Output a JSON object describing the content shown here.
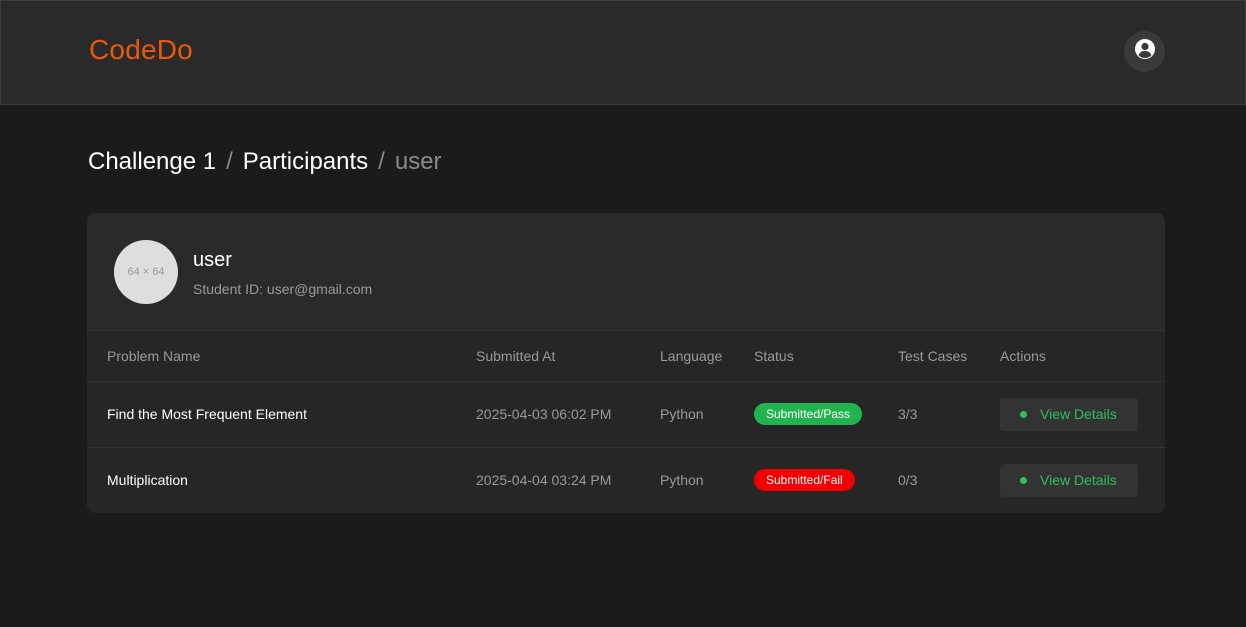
{
  "app": {
    "brand": "CodeDo"
  },
  "header": {
    "account_icon": "user-circle-icon"
  },
  "breadcrumb": {
    "items": [
      "Challenge 1",
      "Participants",
      "user"
    ],
    "separator": "/"
  },
  "profile": {
    "avatar_placeholder": "64 × 64",
    "name": "user",
    "student_id": "Student ID: user@gmail.com"
  },
  "table": {
    "headers": [
      "Problem Name",
      "Submitted At",
      "Language",
      "Status",
      "Test Cases",
      "Actions"
    ],
    "rows": [
      {
        "problem": "Find the Most Frequent Element",
        "submitted_at": "2025-04-03 06:02 PM",
        "language": "Python",
        "status": "Submitted/Pass",
        "status_color": "#22b34f",
        "test_cases": "3/3",
        "action": "View Details"
      },
      {
        "problem": "Multiplication",
        "submitted_at": "2025-04-04 03:24 PM",
        "language": "Python",
        "status": "Submitted/Fail",
        "status_color": "#f00000",
        "test_cases": "0/3",
        "action": "View Details"
      }
    ]
  },
  "colors": {
    "brand": "#e8590c",
    "accent_green": "#2fbf5f",
    "background": "#1b1b1b",
    "surface": "#2a2a2a"
  }
}
